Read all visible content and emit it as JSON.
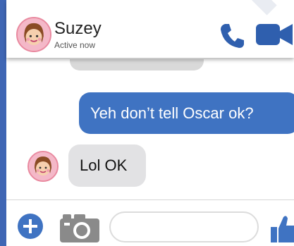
{
  "header": {
    "contact_name": "Suzey",
    "status": "Active now",
    "icons": [
      "phone-icon",
      "video-camera-icon"
    ]
  },
  "conversation": {
    "messages": [
      {
        "from": "me",
        "text": "Yeh don’t tell Oscar ok?"
      },
      {
        "from": "Suzey",
        "text": "Lol OK"
      }
    ]
  },
  "composer": {
    "input_value": "",
    "icons": [
      "add-icon",
      "camera-icon",
      "like-icon"
    ]
  },
  "colors": {
    "accent": "#3f73c2",
    "frame_background": "#3f66b4",
    "incoming_bubble": "#e2e2e4",
    "outgoing_bubble": "#3f73c2"
  }
}
